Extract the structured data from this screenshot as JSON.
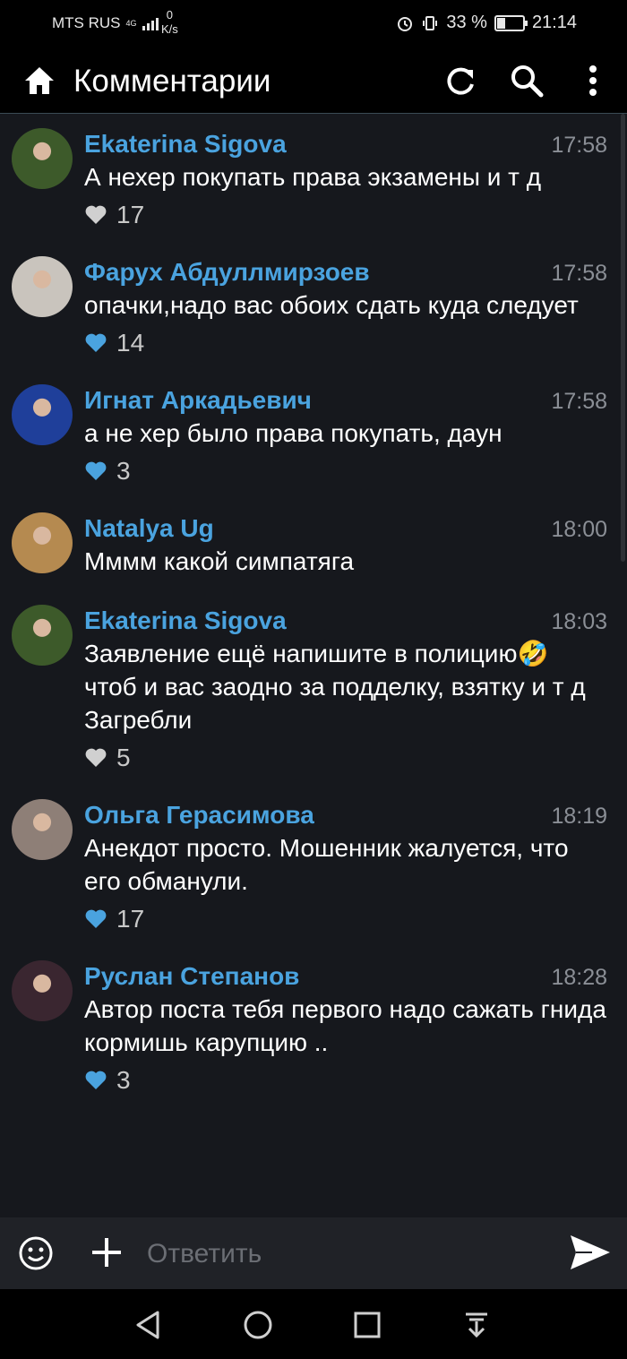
{
  "status_bar": {
    "carrier": "MTS RUS",
    "network": "4G",
    "speed_value": "0",
    "speed_unit": "K/s",
    "battery_percent": 33,
    "battery_text": "33 %",
    "time": "21:14"
  },
  "app_bar": {
    "title": "Комментарии",
    "icons": [
      "home-icon",
      "refresh-icon",
      "search-icon",
      "more-vertical-icon"
    ]
  },
  "comments": [
    {
      "author": "Ekaterina Sigova",
      "time": "17:58",
      "text": "А нехер покупать права экзамены и т д",
      "likes": "17",
      "liked": false,
      "avatar_color": "#3d5a2a"
    },
    {
      "author": "Фарух Абдуллмирзоев",
      "time": "17:58",
      "text": "опачки,надо вас обоих сдать куда следует",
      "likes": "14",
      "liked": true,
      "avatar_color": "#c9c4bd"
    },
    {
      "author": "Игнат Аркадьевич",
      "time": "17:58",
      "text": "а не хер было права покупать, даун",
      "likes": "3",
      "liked": true,
      "avatar_color": "#1f3f9a"
    },
    {
      "author": "Natalya Ug",
      "time": "18:00",
      "text": "Мммм какой симпатяга",
      "likes": "",
      "liked": false,
      "avatar_color": "#b58a50"
    },
    {
      "author": "Ekaterina Sigova",
      "time": "18:03",
      "text": "Заявление ещё напишите в полицию🤣 чтоб и вас заодно за подделку, взятку и т д Загребли",
      "likes": "5",
      "liked": false,
      "avatar_color": "#3d5a2a"
    },
    {
      "author": "Ольга Герасимова",
      "time": "18:19",
      "text": "Анекдот просто. Мошенник жалуется, что его обманули.",
      "likes": "17",
      "liked": true,
      "avatar_color": "#8e7f77"
    },
    {
      "author": "Руслан Степанов",
      "time": "18:28",
      "text": "Автор поста тебя первого надо сажать гнида кормишь карупцию ..",
      "likes": "3",
      "liked": true,
      "avatar_color": "#3a2630"
    }
  ],
  "input_bar": {
    "placeholder": "Ответить",
    "icons": [
      "emoji-icon",
      "plus-icon",
      "send-icon"
    ]
  },
  "colors": {
    "accent": "#4aa3df",
    "background": "#16181d",
    "liked_heart": "#4aa3df",
    "unliked_heart": "#d0d0d0"
  }
}
